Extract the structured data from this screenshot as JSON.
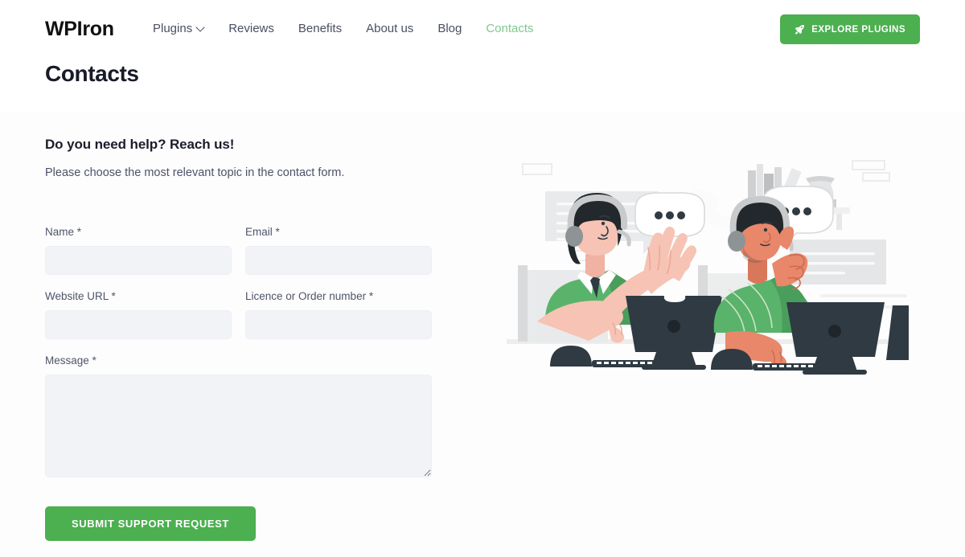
{
  "header": {
    "logo": "WPIron",
    "nav": [
      {
        "label": "Plugins",
        "has_dropdown": true,
        "active": false,
        "icon": "chevron-down-icon"
      },
      {
        "label": "Reviews",
        "has_dropdown": false,
        "active": false
      },
      {
        "label": "Benefits",
        "has_dropdown": false,
        "active": false
      },
      {
        "label": "About us",
        "has_dropdown": false,
        "active": false
      },
      {
        "label": "Blog",
        "has_dropdown": false,
        "active": false
      },
      {
        "label": "Contacts",
        "has_dropdown": false,
        "active": true
      }
    ],
    "cta": {
      "label": "EXPLORE PLUGINS",
      "icon": "rocket-icon",
      "color": "#4caf50"
    },
    "page_title": "Contacts"
  },
  "section": {
    "heading": "Do you need help? Reach us!",
    "subheading": "Please choose the most relevant topic in the contact form."
  },
  "form": {
    "fields": [
      {
        "label": "Name *",
        "value": "",
        "placeholder": "",
        "type": "text",
        "name": "name-input"
      },
      {
        "label": "Email *",
        "value": "",
        "placeholder": "",
        "type": "text",
        "name": "email-input"
      },
      {
        "label": "Website URL *",
        "value": "",
        "placeholder": "",
        "type": "text",
        "name": "website-url-input"
      },
      {
        "label": "Licence or Order number *",
        "value": "",
        "placeholder": "",
        "type": "text",
        "name": "licence-order-number-input"
      },
      {
        "label": "Message *",
        "value": "",
        "placeholder": "",
        "type": "textarea",
        "name": "message-textarea"
      }
    ],
    "submit_label": "SUBMIT SUPPORT REQUEST"
  },
  "illustration": {
    "name": "customer-support-agents-illustration",
    "description": "Two headset-wearing support agents at desktop computers with chat bubbles, documents and a phone handset in the background",
    "colors": {
      "green_shirt": "#59b36b",
      "skin_light": "#f6c3b4",
      "skin_dark": "#e8876a",
      "monitor": "#2f3a42",
      "paper": "#e6e7e8",
      "bubble": "#ffffff"
    }
  },
  "theme": {
    "accent": "#4caf50",
    "accent_light": "#7ec98a",
    "text_dark": "#1b1d2a",
    "text_muted": "#4f5468",
    "input_bg": "#f1f3f7",
    "page_bg": "#ffffff",
    "section_bg": "#fdfdfe"
  }
}
